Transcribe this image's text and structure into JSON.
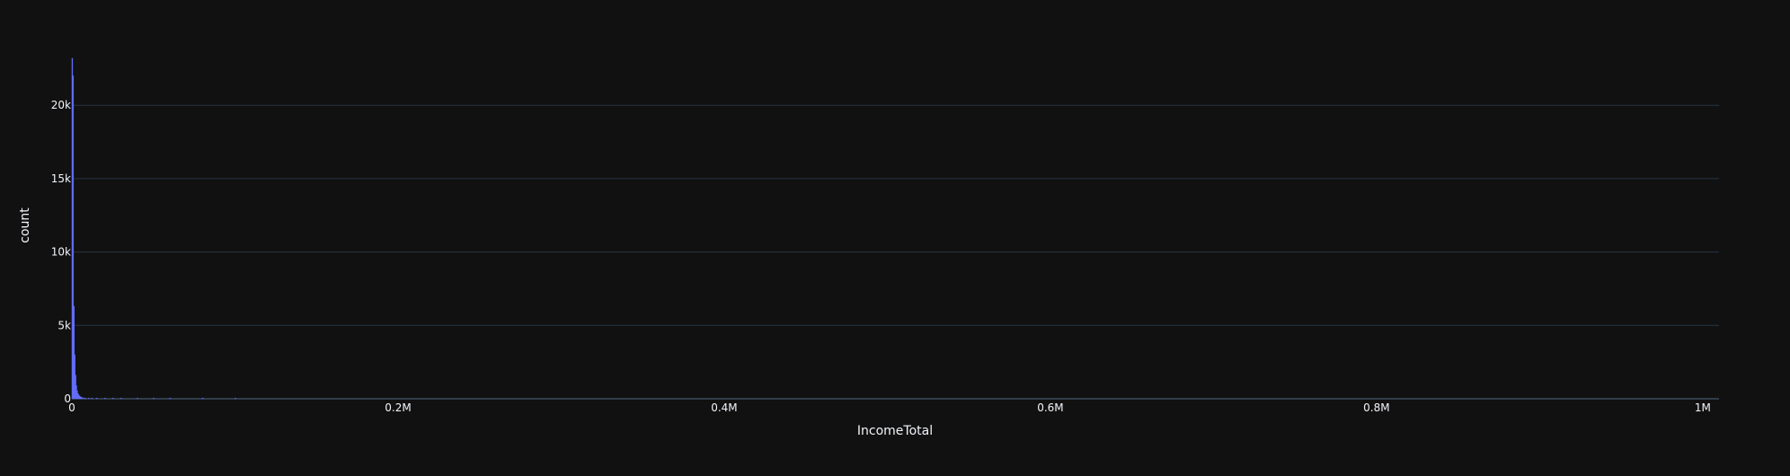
{
  "colors": {
    "background": "#111111",
    "grid": "#283442",
    "zeroline": "#506784",
    "text": "#f2f5fa",
    "bar": "#636efa"
  },
  "chart_data": {
    "type": "bar",
    "subtype": "histogram",
    "title": "",
    "xlabel": "IncomeTotal",
    "ylabel": "count",
    "xlim": [
      0,
      1010000
    ],
    "ylim": [
      0,
      23500
    ],
    "grid": true,
    "legend": "none",
    "x_ticks": [
      {
        "value": 0,
        "label": "0"
      },
      {
        "value": 200000,
        "label": "0.2M"
      },
      {
        "value": 400000,
        "label": "0.4M"
      },
      {
        "value": 600000,
        "label": "0.6M"
      },
      {
        "value": 800000,
        "label": "0.8M"
      },
      {
        "value": 1000000,
        "label": "1M"
      }
    ],
    "y_ticks": [
      {
        "value": 0,
        "label": "0"
      },
      {
        "value": 5000,
        "label": "5k"
      },
      {
        "value": 10000,
        "label": "10k"
      },
      {
        "value": 15000,
        "label": "15k"
      },
      {
        "value": 20000,
        "label": "20k"
      }
    ],
    "bin_width": 500,
    "bins": [
      {
        "x0": 0,
        "count": 23200
      },
      {
        "x0": 500,
        "count": 22000
      },
      {
        "x0": 1000,
        "count": 6300
      },
      {
        "x0": 1500,
        "count": 3000
      },
      {
        "x0": 2000,
        "count": 1600
      },
      {
        "x0": 2500,
        "count": 900
      },
      {
        "x0": 3000,
        "count": 550
      },
      {
        "x0": 3500,
        "count": 350
      },
      {
        "x0": 4000,
        "count": 250
      },
      {
        "x0": 4500,
        "count": 180
      },
      {
        "x0": 5000,
        "count": 130
      },
      {
        "x0": 5500,
        "count": 100
      },
      {
        "x0": 6000,
        "count": 80
      },
      {
        "x0": 7000,
        "count": 60
      },
      {
        "x0": 8000,
        "count": 45
      },
      {
        "x0": 10000,
        "count": 30
      },
      {
        "x0": 12000,
        "count": 20
      },
      {
        "x0": 15000,
        "count": 15
      },
      {
        "x0": 20000,
        "count": 10
      },
      {
        "x0": 25000,
        "count": 8
      },
      {
        "x0": 30000,
        "count": 5
      },
      {
        "x0": 40000,
        "count": 4
      },
      {
        "x0": 50000,
        "count": 3
      },
      {
        "x0": 60000,
        "count": 2
      },
      {
        "x0": 80000,
        "count": 2
      },
      {
        "x0": 100000,
        "count": 1
      }
    ]
  }
}
